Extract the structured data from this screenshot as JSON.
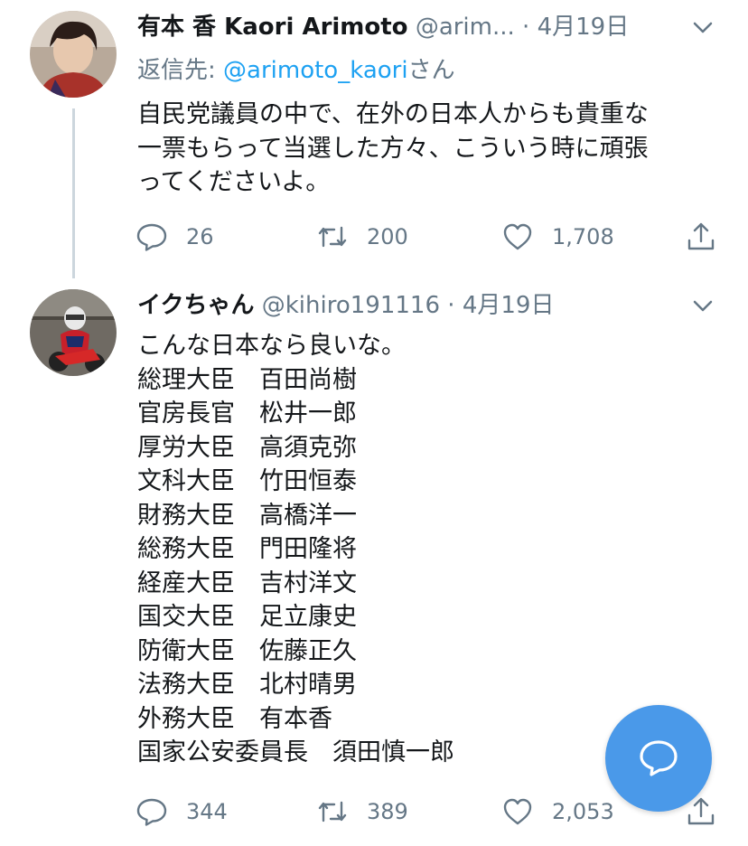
{
  "tweets": [
    {
      "name": "有本 香 Kaori Arimoto",
      "handle": "@arim...",
      "dot": "·",
      "date": "4月19日",
      "reply_prefix": "返信先: ",
      "reply_handle": "@arimoto_kaori",
      "reply_suffix": "さん",
      "text": "自民党議員の中で、在外の日本人からも貴重な\n一票もらって当選した方々、こういう時に頑張\nってくださいよ。",
      "replies": "26",
      "retweets": "200",
      "likes": "1,708"
    },
    {
      "name": "イクちゃん",
      "handle": "@kihiro191116",
      "dot": "·",
      "date": "4月19日",
      "text": "こんな日本なら良いな。\n総理大臣　百田尚樹\n官房長官　松井一郎\n厚労大臣　高須克弥\n文科大臣　竹田恒泰\n財務大臣　高橋洋一\n総務大臣　門田隆将\n経産大臣　吉村洋文\n国交大臣　足立康史\n防衛大臣　佐藤正久\n法務大臣　北村晴男\n外務大臣　有本香\n国家公安委員長　須田慎一郎",
      "replies": "344",
      "retweets": "389",
      "likes": "2,053"
    }
  ],
  "icons": {
    "reply": "reply-icon",
    "retweet": "retweet-icon",
    "like": "heart-icon",
    "share": "share-icon",
    "caret": "chevron-down-icon",
    "compose": "compose-reply-icon"
  },
  "colors": {
    "link": "#1da1f2",
    "secondary_text": "#657786",
    "fab": "#4a99e9",
    "thread_line": "#ccd6dd"
  }
}
